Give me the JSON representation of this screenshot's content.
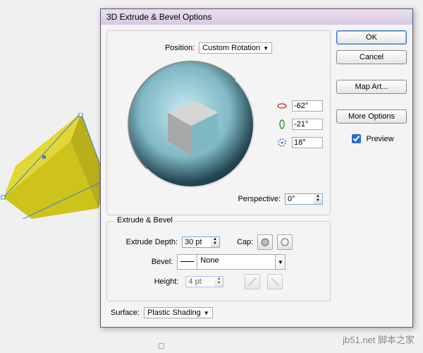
{
  "dialog": {
    "title": "3D Extrude & Bevel Options",
    "position_label": "Position:",
    "position_value": "Custom Rotation",
    "angles": {
      "x": "-62°",
      "y": "-21°",
      "z": "18°"
    },
    "perspective_label": "Perspective:",
    "perspective_value": "0°",
    "extrude_title": "Extrude & Bevel",
    "extrude_depth_label": "Extrude Depth:",
    "extrude_depth_value": "30 pt",
    "cap_label": "Cap:",
    "bevel_label": "Bevel:",
    "bevel_value": "None",
    "height_label": "Height:",
    "height_value": "4 pt",
    "surface_label": "Surface:",
    "surface_value": "Plastic Shading"
  },
  "buttons": {
    "ok": "OK",
    "cancel": "Cancel",
    "mapart": "Map Art...",
    "more": "More Options",
    "preview": "Preview"
  },
  "watermark": "jb51.net 脚本之家"
}
